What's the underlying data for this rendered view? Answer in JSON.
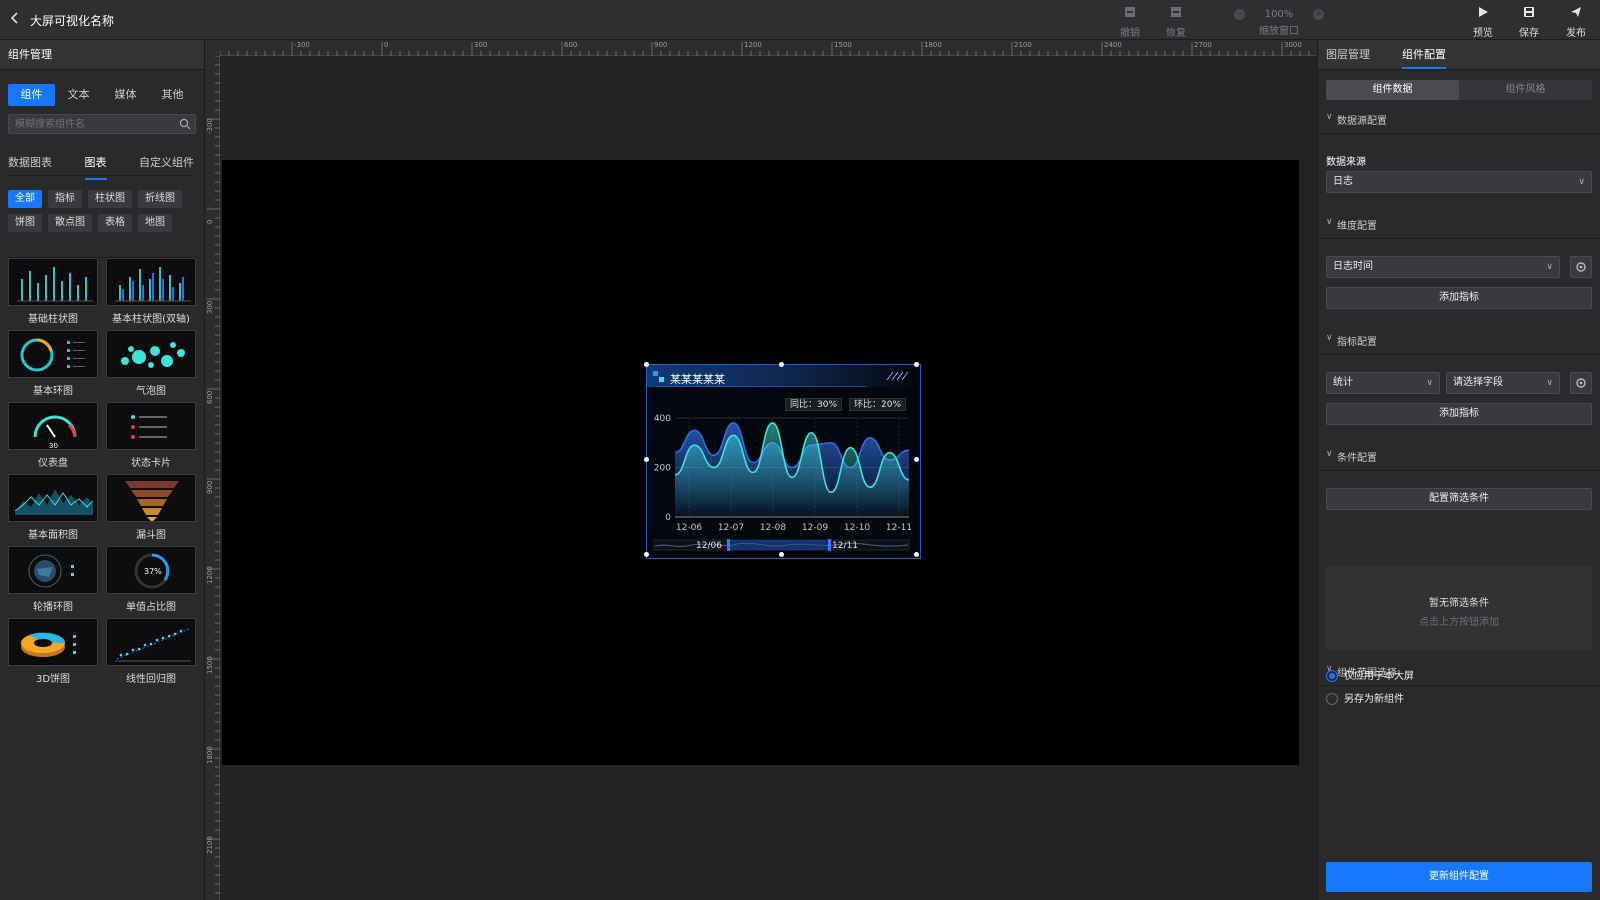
{
  "topbar": {
    "title": "大屏可视化名称",
    "undo": "撤销",
    "redo": "恢复",
    "zoom_value": "100%",
    "zoom_label": "缩放窗口",
    "preview": "预览",
    "save": "保存",
    "publish": "发布"
  },
  "left": {
    "header": "组件管理",
    "seg": [
      "组件",
      "文本",
      "媒体",
      "其他"
    ],
    "search_placeholder": "模糊搜索组件名",
    "cat_tabs": [
      "数据图表",
      "图表",
      "自定义组件"
    ],
    "chips": [
      "全部",
      "指标",
      "柱状图",
      "折线图",
      "饼图",
      "散点图",
      "表格",
      "地图"
    ],
    "thumbs": [
      "基础柱状图",
      "基本柱状图(双轴)",
      "基本环图",
      "气泡图",
      "仪表盘",
      "状态卡片",
      "基本面积图",
      "漏斗图",
      "轮播环图",
      "单值占比图",
      "3D饼图",
      "线性回归图"
    ],
    "gauge_value": "30",
    "ring_value": "37%"
  },
  "ruler": {
    "h": [
      "-300",
      "0",
      "300",
      "600",
      "900",
      "1200",
      "1500",
      "1800",
      "2100",
      "2400",
      "2700",
      "3000"
    ],
    "v": [
      "-300",
      "0",
      "300",
      "600",
      "900",
      "1200",
      "1500",
      "1800",
      "2100"
    ]
  },
  "widget": {
    "title": "某某某某某",
    "yoy": "同比：30%",
    "mom": "环比：20%",
    "slider_start": "12/06",
    "slider_end": "12/11"
  },
  "chart_data": {
    "type": "area",
    "x": [
      "12-06",
      "12-07",
      "12-08",
      "12-09",
      "12-10",
      "12-11"
    ],
    "yticks": [
      "400",
      "200",
      "0"
    ],
    "ylim": [
      0,
      400
    ],
    "series": [
      {
        "values": [
          260,
          350,
          250,
          380,
          220,
          300,
          200,
          290,
          300,
          200,
          320,
          230,
          270
        ]
      },
      {
        "values": [
          170,
          290,
          200,
          330,
          180,
          380,
          160,
          340,
          100,
          280,
          120,
          260,
          150
        ]
      }
    ]
  },
  "right": {
    "tabs": [
      "图层管理",
      "组件配置"
    ],
    "seg": [
      "组件数据",
      "组件风格"
    ],
    "sec_datasource": "数据源配置",
    "datasource_label": "数据来源",
    "datasource_value": "日志",
    "sec_dimension": "维度配置",
    "dimension_value": "日志时间",
    "add_metric_1": "添加指标",
    "sec_metric": "指标配置",
    "metric_agg": "统计",
    "metric_field": "请选择字段",
    "add_metric_2": "添加指标",
    "sec_condition": "条件配置",
    "filter_button": "配置筛选条件",
    "empty_title": "暂无筛选条件",
    "empty_hint": "点击上方按钮添加",
    "sec_scope": "组件范围选择",
    "radio_1": "仅应用于本大屏",
    "radio_2": "另存为新组件",
    "update_button": "更新组件配置"
  },
  "colors": {
    "accent": "#1677ff",
    "line1": "#2f6fe0",
    "line2": "#3ee2d6"
  }
}
